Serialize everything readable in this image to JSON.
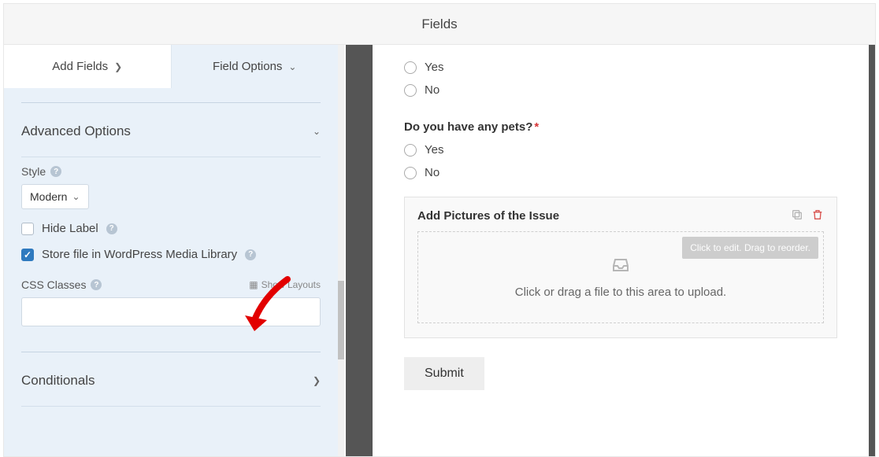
{
  "header": {
    "title": "Fields"
  },
  "tabs": {
    "add_fields": "Add Fields",
    "field_options": "Field Options"
  },
  "sidebar": {
    "section_advanced": "Advanced Options",
    "style": {
      "label": "Style",
      "value": "Modern"
    },
    "hide_label": "Hide Label",
    "store_media": "Store file in WordPress Media Library",
    "css_classes": "CSS Classes",
    "show_layouts": "Show Layouts",
    "section_conditionals": "Conditionals"
  },
  "preview": {
    "q1": {
      "options": [
        "Yes",
        "No"
      ]
    },
    "q2": {
      "label": "Do you have any pets?",
      "options": [
        "Yes",
        "No"
      ]
    },
    "upload": {
      "title": "Add Pictures of the Issue",
      "hint": "Click to edit. Drag to reorder.",
      "dropzone": "Click or drag a file to this area to upload."
    },
    "submit": "Submit"
  }
}
